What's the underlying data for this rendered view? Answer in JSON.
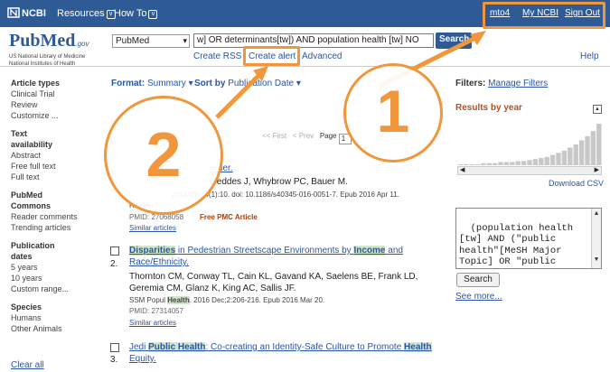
{
  "topbar": {
    "brand": "NCBI",
    "resources": "Resources",
    "howto": "How To",
    "user": "mto4",
    "mync bi": "My NCBI",
    "myncbi": "My NCBI",
    "signout": "Sign Out"
  },
  "logo": {
    "pub": "Pub",
    "med": "Med",
    "gov": ".gov",
    "line1": "US National Library of Medicine",
    "line2": "National Institutes of Health"
  },
  "search": {
    "database": "PubMed",
    "query": "w] OR determinants[tw]) AND population health [tw] NO",
    "button": "Search"
  },
  "sublinks": {
    "rss": "Create RSS",
    "alert": "Create alert",
    "advanced": "Advanced",
    "help": "Help"
  },
  "sidebar": {
    "groups": [
      {
        "heading": "Article types",
        "items": [
          "Clinical Trial",
          "Review",
          "Customize ..."
        ]
      },
      {
        "heading": "Text availability",
        "items": [
          "Abstract",
          "Free full text",
          "Full text"
        ]
      },
      {
        "heading": "PubMed Commons",
        "items": [
          "Reader comments",
          "Trending articles"
        ]
      },
      {
        "heading": "Publication dates",
        "items": [
          "5 years",
          "10 years",
          "Custom range..."
        ]
      },
      {
        "heading": "Species",
        "items": [
          "Humans",
          "Other Animals"
        ]
      }
    ],
    "clear_all": "Clear all"
  },
  "toolbar": {
    "format_label": "Format:",
    "format_value": "Summary",
    "sort_label": "Sort by",
    "sort_value": "Publication Date"
  },
  "pager": {
    "first": "<< First",
    "prev": "< Prev",
    "page_label": "Page",
    "page_value": "1"
  },
  "results": [
    {
      "number": "1.",
      "title_partial": "order.",
      "authors": "Geddes J, Whybrow PC, Bauer M.",
      "journal": "2016 Dec;4(1):10. doi: 10.1186/s40345-016-0051-7. Epub 2016 Apr 11.",
      "type": "Review.",
      "pmid": "PMID: 27068058",
      "free": "Free PMC Article",
      "similar": "Similar articles"
    },
    {
      "number": "2.",
      "title_a": "Disparities",
      "title_b": " in Pedestrian Streetscape Environments by ",
      "title_c": "Income",
      "title_d": " and Race/Ethnicity.",
      "authors": "Thornton CM, Conway TL, Cain KL, Gavand KA, Saelens BE, Frank LD, Geremia CM, Glanz K, King AC, Sallis JF.",
      "journal_a": "SSM Popul ",
      "journal_b": "Health",
      "journal_c": ". 2016 Dec;2:206-216. Epub 2016 Mar 20.",
      "pmid": "PMID: 27314057",
      "similar": "Similar articles"
    },
    {
      "number": "3.",
      "title_a": "Jedi ",
      "title_b": "Public Health",
      "title_c": ": Co-creating an Identity-Safe Culture to Promote ",
      "title_d": "Health",
      "title_e": " Equity."
    }
  ],
  "right": {
    "filters_label": "Filters:",
    "manage_filters": "Manage Filters",
    "results_by_year": "Results by year",
    "download_csv": "Download CSV",
    "query_text": "(population health\n[tw] AND (\"public\nhealth\"[MeSH Major\nTopic] OR \"public\nhealth",
    "search_button": "Search",
    "see_more": "See more..."
  },
  "callouts": {
    "one": "1",
    "two": "2"
  },
  "results_by_year_bars": [
    1,
    1,
    1,
    1,
    2,
    2,
    2,
    3,
    3,
    3,
    4,
    4,
    5,
    6,
    7,
    8,
    10,
    12,
    14,
    17,
    20,
    24,
    28,
    33,
    40
  ],
  "colors": {
    "topbar": "#2e5b96",
    "callout": "#f0963c",
    "link": "#2a55a5",
    "highlight": "#cfe6c9"
  }
}
